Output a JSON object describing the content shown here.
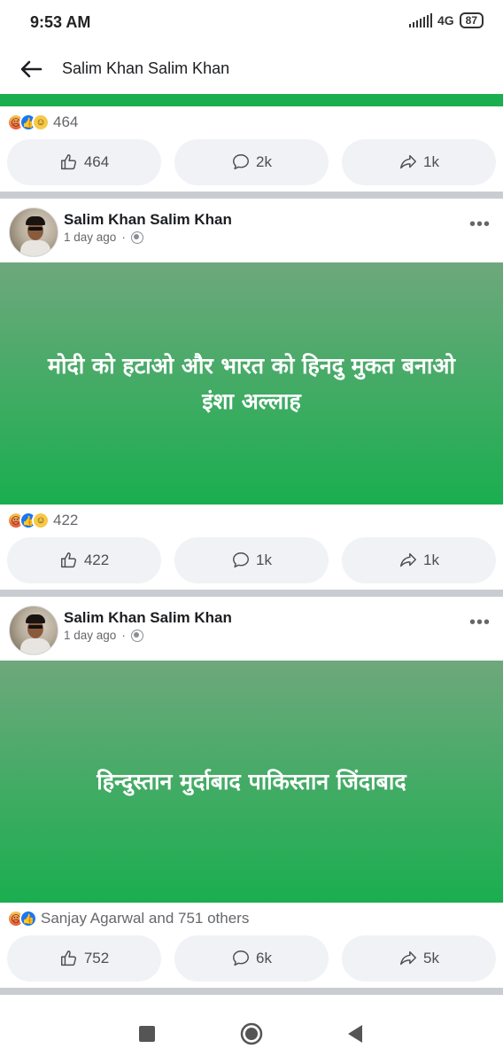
{
  "status": {
    "time": "9:53 AM",
    "network": "4G",
    "battery": "87"
  },
  "header": {
    "title": "Salim Khan Salim Khan"
  },
  "posts": [
    {
      "reaction_count": "464",
      "like_count": "464",
      "comment_count": "2k",
      "share_count": "1k"
    },
    {
      "author": "Salim Khan Salim Khan",
      "time": "1 day ago",
      "text_line1": "मोदी को हटाओ और भारत को हिनदु मुकत बनाओ",
      "text_line2": "इंशा अल्लाह",
      "reaction_count": "422",
      "like_count": "422",
      "comment_count": "1k",
      "share_count": "1k"
    },
    {
      "author": "Salim Khan Salim Khan",
      "time": "1 day ago",
      "text_line1": "हिन्दुस्तान मुर्दाबाद पाकिस्तान जिंदाबाद",
      "reaction_count": "Sanjay Agarwal and 751 others",
      "like_count": "752",
      "comment_count": "6k",
      "share_count": "5k"
    }
  ],
  "colors": {
    "post_green": "#1aae4f",
    "separator": "#c9ccd1",
    "button_bg": "#f0f2f5"
  }
}
